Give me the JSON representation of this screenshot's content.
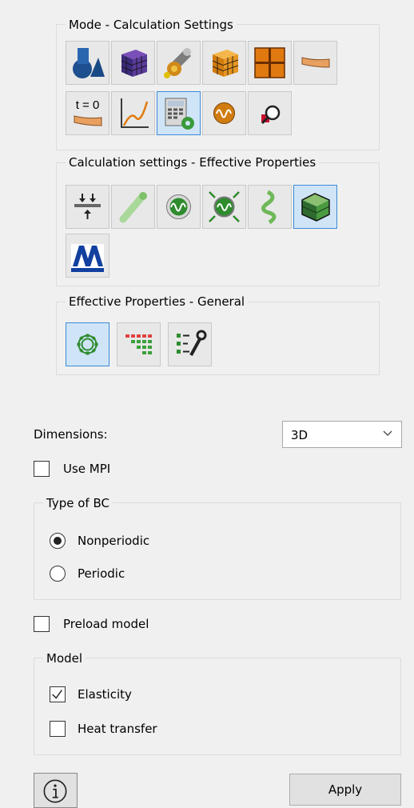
{
  "groups": {
    "mode": {
      "legend": "Mode - Calculation Settings",
      "tools": [
        {
          "icon": "geometry-shapes-icon",
          "selected": false
        },
        {
          "icon": "voxel-mesh-cube-icon",
          "selected": false
        },
        {
          "icon": "material-tools-icon",
          "selected": false
        },
        {
          "icon": "orange-mesh-cube-icon",
          "selected": false
        },
        {
          "icon": "grid-icon",
          "selected": false
        },
        {
          "icon": "beam-icon",
          "selected": false
        },
        {
          "icon": "initial-time-icon",
          "time_label": "t = 0",
          "selected": false
        },
        {
          "icon": "curve-chart-icon",
          "selected": false
        },
        {
          "icon": "calculator-settings-icon",
          "selected": true
        },
        {
          "icon": "wave-icon",
          "selected": false
        },
        {
          "icon": "magnifier-icon",
          "selected": false
        }
      ]
    },
    "effective": {
      "legend": "Calculation settings - Effective Properties",
      "tools": [
        {
          "icon": "compression-icon",
          "selected": false
        },
        {
          "icon": "fiber-icon",
          "selected": false
        },
        {
          "icon": "green-wave-icon",
          "selected": false
        },
        {
          "icon": "wave-arrows-icon",
          "selected": false
        },
        {
          "icon": "spiral-icon",
          "selected": false
        },
        {
          "icon": "green-cube-icon",
          "selected": true
        },
        {
          "icon": "automechanics-logo-icon",
          "selected": false
        }
      ]
    },
    "general": {
      "legend": "Effective Properties - General",
      "tools": [
        {
          "icon": "gear-icon",
          "selected": true
        },
        {
          "icon": "matrix-triangle-icon",
          "selected": false
        },
        {
          "icon": "settings-list-icon",
          "selected": false
        }
      ]
    }
  },
  "dimensions": {
    "label": "Dimensions:",
    "value": "3D"
  },
  "use_mpi": {
    "label": "Use MPI",
    "checked": false
  },
  "type_of_bc": {
    "legend": "Type of BC",
    "options": [
      {
        "label": "Nonperiodic",
        "selected": true
      },
      {
        "label": "Periodic",
        "selected": false
      }
    ]
  },
  "preload_model": {
    "label": "Preload model",
    "checked": false
  },
  "model": {
    "legend": "Model",
    "options": [
      {
        "label": "Elasticity",
        "checked": true
      },
      {
        "label": "Heat transfer",
        "checked": false
      }
    ]
  },
  "footer": {
    "info_icon": "info-icon",
    "apply_label": "Apply"
  },
  "colors": {
    "selected_border": "#3c8ad6",
    "selected_fill": "#cfe5f7",
    "panel": "#f0f0f0"
  }
}
